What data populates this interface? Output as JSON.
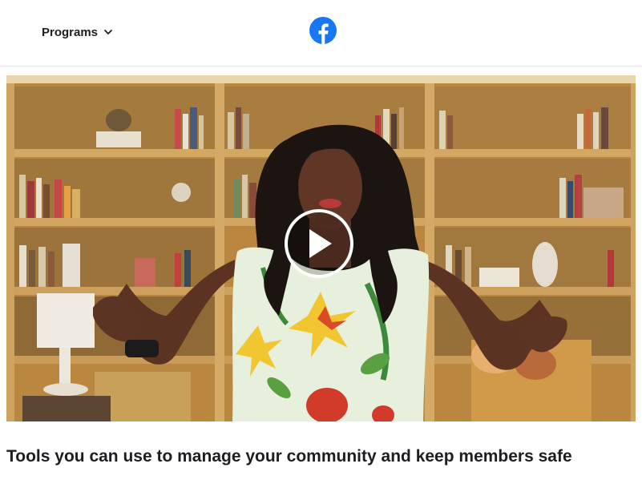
{
  "header": {
    "nav": {
      "programs_label": "Programs",
      "chevron_icon": "chevron-down-icon"
    },
    "logo": {
      "name": "facebook-logo-icon",
      "color": "#1877f2"
    }
  },
  "video": {
    "play_icon": "play-icon",
    "thumbnail_description_colors": {
      "shelf_wood": "#c9994f",
      "background": "#b88a48"
    }
  },
  "main": {
    "headline": "Tools you can use to manage your community and keep members safe"
  }
}
